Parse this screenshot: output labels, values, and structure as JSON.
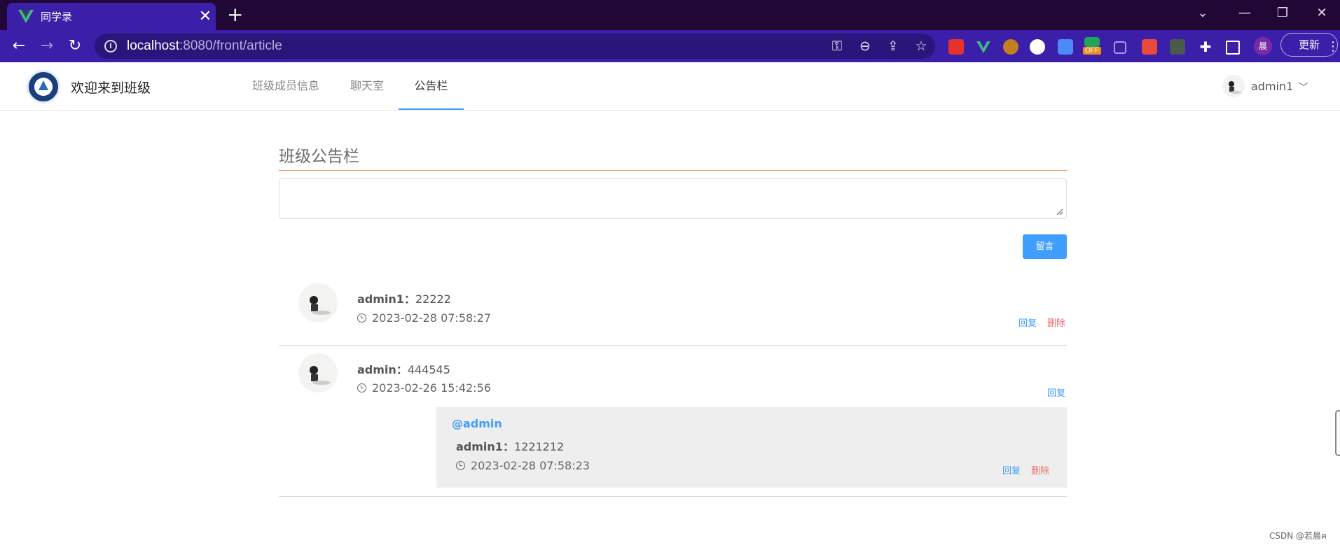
{
  "browser": {
    "tab_title": "同学录",
    "tab_close": "✕",
    "new_tab": "+",
    "url_host": "localhost",
    "url_path": ":8080/front/article",
    "update_label": "更新",
    "profile_initial": "晨",
    "ext_off_badge": "OFF",
    "window_controls": [
      "⌄",
      "—",
      "❐",
      "✕"
    ]
  },
  "header": {
    "site_title": "欢迎来到班级",
    "nav": [
      {
        "label": "班级成员信息",
        "active": false
      },
      {
        "label": "聊天室",
        "active": false
      },
      {
        "label": "公告栏",
        "active": true
      }
    ],
    "user_name": "admin1"
  },
  "board": {
    "title": "班级公告栏",
    "input_value": "",
    "submit_label": "留言"
  },
  "comments": [
    {
      "author": "admin1",
      "separator": "：",
      "content": "22222",
      "time": "2023-02-28 07:58:27",
      "reply_label": "回复",
      "delete_label": "删除"
    },
    {
      "author": "admin",
      "separator": "：",
      "content": "444545",
      "time": "2023-02-26 15:42:56",
      "reply_label": "回复",
      "replies": [
        {
          "at_user": "@admin",
          "author": "admin1",
          "separator": "：",
          "content": "1221212",
          "time": "2023-02-28 07:58:23",
          "reply_label": "回复",
          "delete_label": "删除"
        }
      ]
    }
  ],
  "watermark": "CSDN @若晨ฅ",
  "colors": {
    "tabbar_bg": "#200735",
    "toolbar_bg": "#3b1fa8",
    "accent": "#409eff",
    "danger": "#f56c6c",
    "title_underline": "#f08a4f"
  }
}
